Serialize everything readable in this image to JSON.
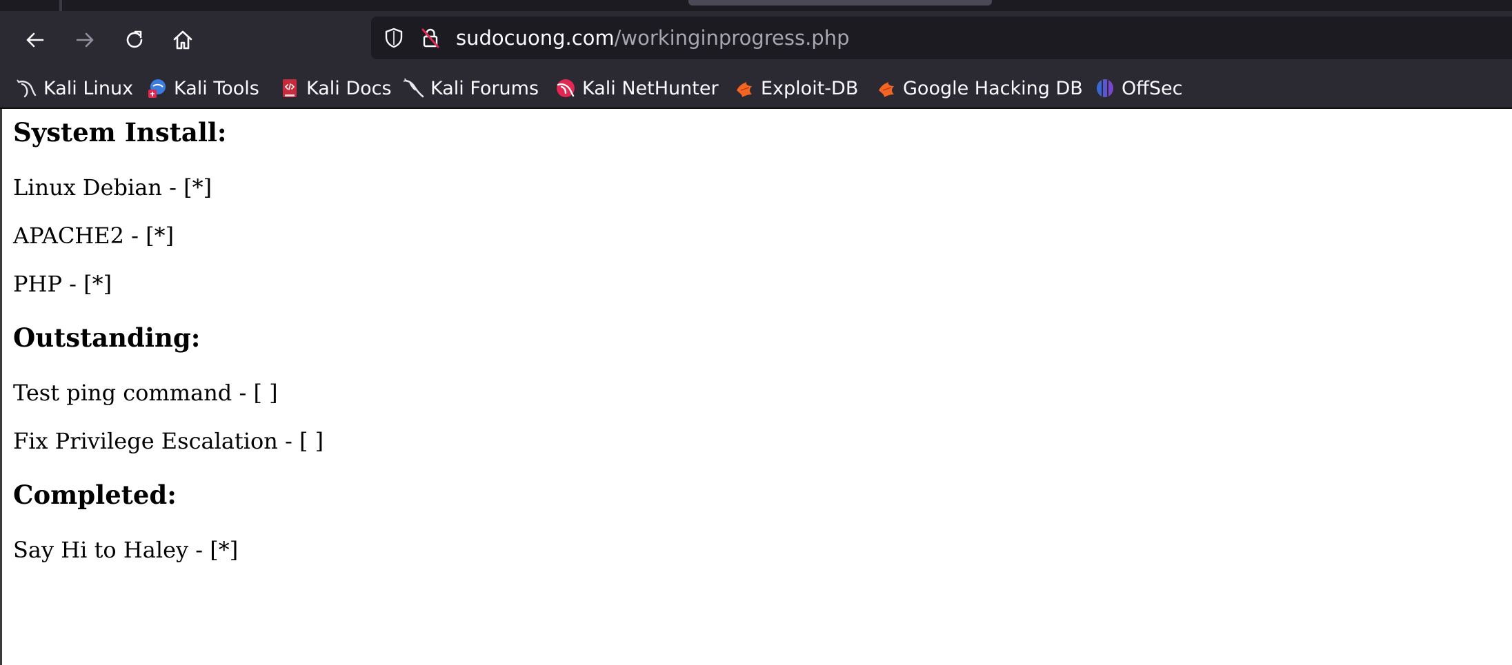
{
  "browser": {
    "url_domain": "sudocuong.com",
    "url_path": "/workinginprogress.php"
  },
  "toolbar": {
    "back_icon": "arrow-left-icon",
    "forward_icon": "arrow-right-icon",
    "reload_icon": "reload-icon",
    "home_icon": "home-icon",
    "shield_icon": "shield-icon",
    "insecure_lock_icon": "lock-crossed-icon",
    "forward_enabled": false
  },
  "bookmarks": [
    {
      "label": "Kali Linux",
      "icon": "kali-dragon-icon"
    },
    {
      "label": "Kali Tools",
      "icon": "kali-tools-icon"
    },
    {
      "label": "Kali Docs",
      "icon": "kali-docs-icon"
    },
    {
      "label": "Kali Forums",
      "icon": "kali-forums-icon"
    },
    {
      "label": "Kali NetHunter",
      "icon": "kali-nethunter-icon"
    },
    {
      "label": "Exploit-DB",
      "icon": "exploit-db-icon"
    },
    {
      "label": "Google Hacking DB",
      "icon": "google-hacking-db-icon"
    },
    {
      "label": "OffSec",
      "icon": "offsec-icon"
    }
  ],
  "page": {
    "sections": [
      {
        "heading": "System Install:",
        "items": [
          "Linux Debian - [*]",
          "APACHE2 - [*]",
          "PHP - [*]"
        ]
      },
      {
        "heading": "Outstanding:",
        "items": [
          "Test ping command - [ ]",
          "Fix Privilege Escalation - [ ]"
        ]
      },
      {
        "heading": "Completed:",
        "items": [
          "Say Hi to Haley - [*]"
        ]
      }
    ]
  },
  "colors": {
    "chrome_bg": "#2b2a33",
    "urlbar_bg": "#1c1b22",
    "chrome_text": "#fbfbfe",
    "url_path_text": "#a8a7b0",
    "page_bg": "#ffffff",
    "insecure_red": "#e22850"
  }
}
